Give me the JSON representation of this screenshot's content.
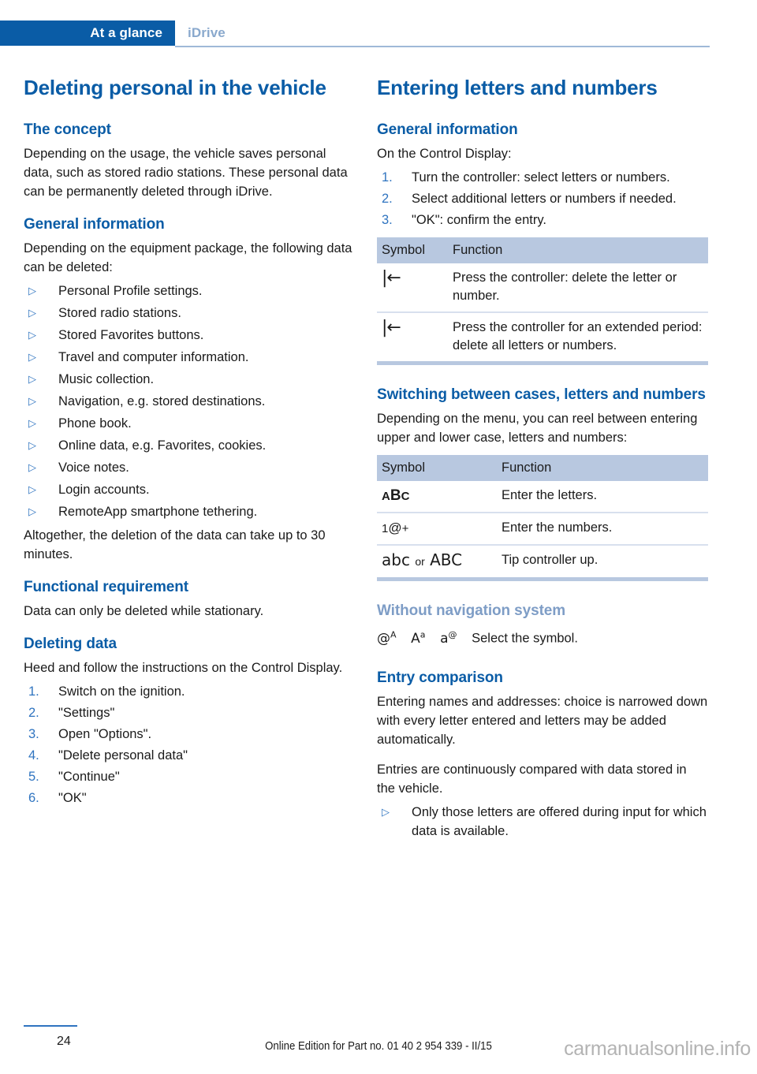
{
  "header": {
    "active_tab": "At a glance",
    "inactive_tab": "iDrive",
    "accent_color": "#0a5ca6"
  },
  "left_column": {
    "title": "Deleting personal in the vehicle",
    "concept": {
      "heading": "The concept",
      "paragraph": "Depending on the usage, the vehicle saves personal data, such as stored radio stations. These personal data can be permanently deleted through iDrive."
    },
    "general_information": {
      "heading": "General information",
      "intro": "Depending on the equipment package, the following data can be deleted:",
      "items": [
        "Personal Profile settings.",
        "Stored radio stations.",
        "Stored Favorites buttons.",
        "Travel and computer information.",
        "Music collection.",
        "Navigation, e.g. stored destinations.",
        "Phone book.",
        "Online data, e.g. Favorites, cookies.",
        "Voice notes.",
        "Login accounts.",
        "RemoteApp smartphone tethering."
      ],
      "outro": "Altogether, the deletion of the data can take up to 30 minutes."
    },
    "functional_requirement": {
      "heading": "Functional requirement",
      "paragraph": "Data can only be deleted while stationary."
    },
    "deleting_data": {
      "heading": "Deleting data",
      "paragraph": "Heed and follow the instructions on the Control Display.",
      "steps": [
        {
          "number": "1.",
          "text": "Switch on the ignition."
        },
        {
          "number": "2.",
          "text": "\"Settings\""
        },
        {
          "number": "3.",
          "text": "Open \"Options\"."
        },
        {
          "number": "4.",
          "text": "\"Delete personal data\""
        },
        {
          "number": "5.",
          "text": "\"Continue\""
        },
        {
          "number": "6.",
          "text": "\"OK\""
        }
      ]
    }
  },
  "right_column": {
    "title": "Entering letters and numbers",
    "general_information": {
      "heading": "General information",
      "intro": "On the Control Display:",
      "steps": [
        {
          "number": "1.",
          "text": "Turn the controller: select letters or numbers."
        },
        {
          "number": "2.",
          "text": "Select additional letters or numbers if needed."
        },
        {
          "number": "3.",
          "text": "\"OK\": confirm the entry."
        }
      ]
    },
    "delete_table": {
      "columns": [
        "Symbol",
        "Function"
      ],
      "rows": [
        {
          "symbol_name": "backspace-icon",
          "symbol_text": "|←",
          "function": "Press the controller: delete the letter or number."
        },
        {
          "symbol_name": "backspace-icon",
          "symbol_text": "|←",
          "function": "Press the controller for an extended period: delete all letters or numbers."
        }
      ]
    },
    "switching": {
      "heading": "Switching between cases, letters and numbers",
      "paragraph": "Depending on the menu, you can reel between entering upper and lower case, letters and numbers:",
      "table": {
        "columns": [
          "Symbol",
          "Function"
        ],
        "rows": [
          {
            "symbol_name": "abc-letters-icon",
            "symbol_text": "ABC",
            "function": "Enter the letters."
          },
          {
            "symbol_name": "numbers-icon",
            "symbol_text": "1@+",
            "function": "Enter the numbers."
          },
          {
            "symbol_name": "case-toggle-icon",
            "symbol_text": "abc or ABC",
            "function": "Tip controller up."
          }
        ]
      }
    },
    "without_navigation": {
      "heading": "Without navigation system",
      "symbols": [
        "@A",
        "Aa",
        "a@"
      ],
      "text": "Select the symbol."
    },
    "entry_comparison": {
      "heading": "Entry comparison",
      "paragraph1": "Entering names and addresses: choice is narrowed down with every letter entered and letters may be added automatically.",
      "paragraph2": "Entries are continuously compared with data stored in the vehicle.",
      "bullets": [
        "Only those letters are offered during input for which data is available."
      ]
    }
  },
  "footer": {
    "page_number": "24",
    "edition": "Online Edition for Part no. 01 40 2 954 339 - II/15",
    "watermark": "carmanualsonline.info"
  }
}
